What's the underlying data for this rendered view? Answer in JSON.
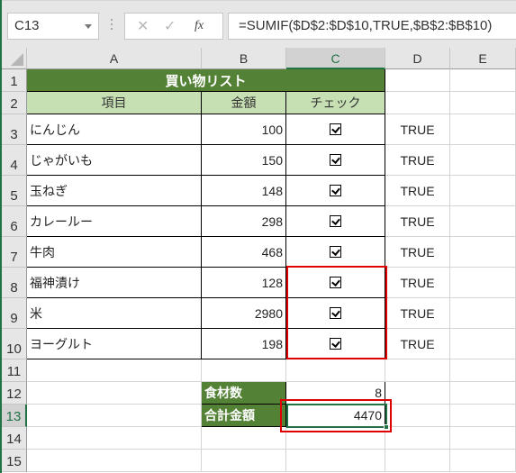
{
  "formula_bar": {
    "name_box": "C13",
    "cancel_icon": "✕",
    "enter_icon": "✓",
    "fx_label": "fx",
    "formula": "=SUMIF($D$2:$D$10,TRUE,$B$2:$B$10)"
  },
  "columns": [
    "A",
    "B",
    "C",
    "D",
    "E"
  ],
  "selected_column": "C",
  "rows": [
    "1",
    "2",
    "3",
    "4",
    "5",
    "6",
    "7",
    "8",
    "9",
    "10",
    "11",
    "12",
    "13",
    "14",
    "15"
  ],
  "selected_row": "13",
  "sheet": {
    "title": "買い物リスト",
    "headers": {
      "item": "項目",
      "price": "金額",
      "check": "チェック"
    },
    "items": [
      {
        "name": "にんじん",
        "price": "100",
        "checked": true,
        "flag": "TRUE"
      },
      {
        "name": "じゃがいも",
        "price": "150",
        "checked": true,
        "flag": "TRUE"
      },
      {
        "name": "玉ねぎ",
        "price": "148",
        "checked": true,
        "flag": "TRUE"
      },
      {
        "name": "カレールー",
        "price": "298",
        "checked": true,
        "flag": "TRUE"
      },
      {
        "name": "牛肉",
        "price": "468",
        "checked": true,
        "flag": "TRUE"
      },
      {
        "name": "福神漬け",
        "price": "128",
        "checked": true,
        "flag": "TRUE"
      },
      {
        "name": "米",
        "price": "2980",
        "checked": true,
        "flag": "TRUE"
      },
      {
        "name": "ヨーグルト",
        "price": "198",
        "checked": true,
        "flag": "TRUE"
      }
    ],
    "summary": {
      "count_label": "食材数",
      "count_value": "8",
      "total_label": "合計金額",
      "total_value": "4470"
    }
  },
  "colors": {
    "title_bg": "#538135",
    "header_bg": "#c6e0b4",
    "highlight": "#e00000",
    "selection": "#217346"
  }
}
